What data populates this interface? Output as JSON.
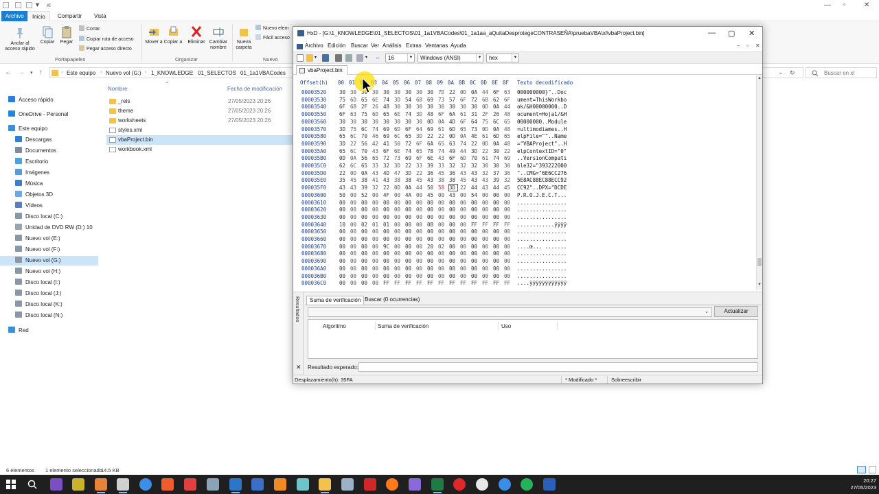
{
  "explorer": {
    "title": "xl",
    "menu": {
      "file": "Archivo",
      "home": "Inicio",
      "share": "Compartir",
      "view": "Vista"
    },
    "ribbon": {
      "pin": "Anclar al acceso rápido",
      "copy": "Copiar",
      "paste": "Pegar",
      "cut": "Cortar",
      "copy_path": "Copiar ruta de acceso",
      "paste_shortcut": "Pegar acceso directo",
      "group_clipboard": "Portapapeles",
      "move_to": "Mover a",
      "copy_to": "Copiar a",
      "delete": "Eliminar",
      "rename": "Cambiar nombre",
      "group_organize": "Organizar",
      "new_folder": "Nueva carpeta",
      "new_item": "Nuevo elem",
      "easy_access": "Fácil acceso",
      "group_new": "Nuevo"
    },
    "breadcrumbs": [
      "Este equipo",
      "Nuevo vol (G:)",
      "1_KNOWLEDGE",
      "01_SELECTOS",
      "01_1a1VBACodes"
    ],
    "search_placeholder": "Buscar en xl",
    "nav": [
      {
        "label": "Acceso rápido",
        "color": "#2a7de1"
      },
      {
        "label": "OneDrive - Personal",
        "color": "#1e88e5"
      },
      {
        "label": "Este equipo",
        "color": "#3b8fd8"
      },
      {
        "label": "Descargas",
        "color": "#2f7fcf"
      },
      {
        "label": "Documentos",
        "color": "#7f8c9a"
      },
      {
        "label": "Escritorio",
        "color": "#4aa3df"
      },
      {
        "label": "Imágenes",
        "color": "#5a9bd5"
      },
      {
        "label": "Música",
        "color": "#3e7fc1"
      },
      {
        "label": "Objetos 3D",
        "color": "#6fa8dc"
      },
      {
        "label": "Vídeos",
        "color": "#5b7fb8"
      },
      {
        "label": "Disco local (C:)",
        "color": "#8a97a5"
      },
      {
        "label": "Unidad de DVD RW (D:) 10",
        "color": "#9aa4ae"
      },
      {
        "label": "Nuevo vol (E:)",
        "color": "#8a97a5"
      },
      {
        "label": "Nuevo vol (F:)",
        "color": "#8a97a5"
      },
      {
        "label": "Nuevo vol (G:)",
        "color": "#8a97a5"
      },
      {
        "label": "Nuevo vol (H:)",
        "color": "#8a97a5"
      },
      {
        "label": "Disco local (I:)",
        "color": "#8a97a5"
      },
      {
        "label": "Disco local (J:)",
        "color": "#8a97a5"
      },
      {
        "label": "Disco local (K:)",
        "color": "#8a97a5"
      },
      {
        "label": "Disco local (N:)",
        "color": "#8a97a5"
      },
      {
        "label": "Red",
        "color": "#3b8fd8"
      }
    ],
    "columns": {
      "name": "Nombre",
      "date": "Fecha de modificación"
    },
    "files": [
      {
        "name": "_rels",
        "date": "27/05/2023 20:26",
        "type": "folder"
      },
      {
        "name": "theme",
        "date": "27/05/2023 20:26",
        "type": "folder"
      },
      {
        "name": "worksheets",
        "date": "27/05/2023 20:26",
        "type": "folder"
      },
      {
        "name": "styles.xml",
        "date": "",
        "type": "doc"
      },
      {
        "name": "vbaProject.bin",
        "date": "",
        "type": "doc"
      },
      {
        "name": "workbook.xml",
        "date": "",
        "type": "doc"
      }
    ],
    "status": {
      "count": "6 elementos",
      "selected": "1 elemento seleccionado",
      "size": "14.5 KB"
    }
  },
  "hxd": {
    "title": "HxD - [G:\\1_KNOWLEDGE\\01_SELECTOS\\01_1a1VBACodes\\01_1a1aa_aQuitaDesprotegeCONTRASEÑA\\pruebaVBA\\xl\\vbaProject.bin]",
    "menu": [
      "Archivo",
      "Edición",
      "Buscar",
      "Ver",
      "Análisis",
      "Extras",
      "Ventanas",
      "Ayuda"
    ],
    "toolbar": {
      "columns": "16",
      "charset": "Windows (ANSI)",
      "base": "hex"
    },
    "tab": "vbaProject.bin",
    "header": {
      "offset": "Offset(h)",
      "cols": [
        "00",
        "01",
        "02",
        "03",
        "04",
        "05",
        "06",
        "07",
        "08",
        "09",
        "0A",
        "0B",
        "0C",
        "0D",
        "0E",
        "0F"
      ],
      "decoded": "Texto decodificado"
    },
    "rows": [
      {
        "off": "00003520",
        "bytes": "30 30 30 30 30 30 30 30 30 7D 22 0D 0A 44 6F 63",
        "text": "000000000}\"..Doc"
      },
      {
        "off": "00003530",
        "bytes": "75 6D 65 6E 74 3D 54 68 69 73 57 6F 72 6B 62 6F",
        "text": "ument=ThisWorkbo"
      },
      {
        "off": "00003540",
        "bytes": "6F 6B 2F 26 48 30 30 30 30 30 30 30 30 0D 0A 44",
        "text": "ok/&H00000000..D"
      },
      {
        "off": "00003550",
        "bytes": "6F 63 75 6D 65 6E 74 3D 48 6F 6A 61 31 2F 26 48",
        "text": "ocument=Hoja1/&H"
      },
      {
        "off": "00003560",
        "bytes": "30 30 30 30 30 30 30 30 0D 0A 4D 6F 64 75 6C 65",
        "text": "00000000..Module"
      },
      {
        "off": "00003570",
        "bytes": "3D 75 6C 74 69 6D 6F 64 69 61 6D 65 73 0D 0A 48",
        "text": "=ultimodiames..H"
      },
      {
        "off": "00003580",
        "bytes": "65 6C 70 46 69 6C 65 3D 22 22 0D 0A 4E 61 6D 65",
        "text": "elpFile=\"\"..Name"
      },
      {
        "off": "00003590",
        "bytes": "3D 22 56 42 41 50 72 6F 6A 65 63 74 22 0D 0A 48",
        "text": "=\"VBAProject\"..H"
      },
      {
        "off": "000035A0",
        "bytes": "65 6C 70 43 6F 6E 74 65 78 74 49 44 3D 22 30 22",
        "text": "elpContextID=\"0\""
      },
      {
        "off": "000035B0",
        "bytes": "0D 0A 56 65 72 73 69 6F 6E 43 6F 6D 70 61 74 69",
        "text": "..VersionCompati"
      },
      {
        "off": "000035C0",
        "bytes": "62 6C 65 33 32 3D 22 33 39 33 32 32 32 30 30 30",
        "text": "ble32=\"393222000"
      },
      {
        "off": "000035D0",
        "bytes": "22 0D 0A 43 4D 47 3D 22 36 45 36 43 43 32 37 36",
        "text": "\"..CMG=\"6E6CC276"
      },
      {
        "off": "000035E0",
        "bytes": "35 45 38 41 43 38 38 45 43 38 38 45 43 43 39 32",
        "text": "5E8AC88EC88ECC92"
      },
      {
        "off": "000035F0",
        "bytes": "43 43 39 32 22 0D 0A 44 50 58 3D 22 44 43 44 45",
        "text": "CC92\"..DPX=\"DCDE"
      },
      {
        "off": "00003600",
        "bytes": "50 00 52 00 4F 00 4A 00 45 00 43 00 54 00 00 00",
        "text": "P.R.O.J.E.C.T..."
      },
      {
        "off": "00003610",
        "bytes": "00 00 00 00 00 00 00 00 00 00 00 00 00 00 00 00",
        "text": "................"
      },
      {
        "off": "00003620",
        "bytes": "00 00 00 00 00 00 00 00 00 00 00 00 00 00 00 00",
        "text": "................"
      },
      {
        "off": "00003630",
        "bytes": "00 00 00 00 00 00 00 00 00 00 00 00 00 00 00 00",
        "text": "................"
      },
      {
        "off": "00003640",
        "bytes": "10 00 02 01 01 00 00 00 0B 00 00 00 FF FF FF FF",
        "text": "............ÿÿÿÿ"
      },
      {
        "off": "00003650",
        "bytes": "00 00 00 00 00 00 00 00 00 00 00 00 00 00 00 00",
        "text": "................"
      },
      {
        "off": "00003660",
        "bytes": "00 00 00 00 00 00 00 00 00 00 00 00 00 00 00 00",
        "text": "................"
      },
      {
        "off": "00003670",
        "bytes": "00 00 00 00 9C 00 00 00 20 02 00 00 00 00 00 00",
        "text": "....œ... ......."
      },
      {
        "off": "00003680",
        "bytes": "00 00 00 00 00 00 00 00 00 00 00 00 00 00 00 00",
        "text": "................"
      },
      {
        "off": "00003690",
        "bytes": "00 00 00 00 00 00 00 00 00 00 00 00 00 00 00 00",
        "text": "................"
      },
      {
        "off": "000036A0",
        "bytes": "00 00 00 00 00 00 00 00 00 00 00 00 00 00 00 00",
        "text": "................"
      },
      {
        "off": "000036B0",
        "bytes": "00 00 00 00 00 00 00 00 00 00 00 00 00 00 00 00",
        "text": "................"
      },
      {
        "off": "000036C0",
        "bytes": "00 00 00 00 FF FF FF FF FF FF FF FF FF FF FF FF",
        "text": "....ÿÿÿÿÿÿÿÿÿÿÿÿ"
      }
    ],
    "results": {
      "side_title": "Resultados",
      "tab_checksum": "Suma de verificación",
      "tab_search": "Buscar (0 ocurrencias)",
      "update_button": "Actualizar",
      "col_algorithm": "Algoritmo",
      "col_checksum": "Suma de verificación",
      "col_use": "Uso",
      "expected_label": "Resultado esperado:"
    },
    "status": {
      "offset": "Desplazamiento(h): 35FA",
      "modified": "* Modificado *",
      "mode": "Sobreescribir"
    }
  },
  "taskbar": {
    "time": "20:27",
    "date": "27/05/2023"
  }
}
